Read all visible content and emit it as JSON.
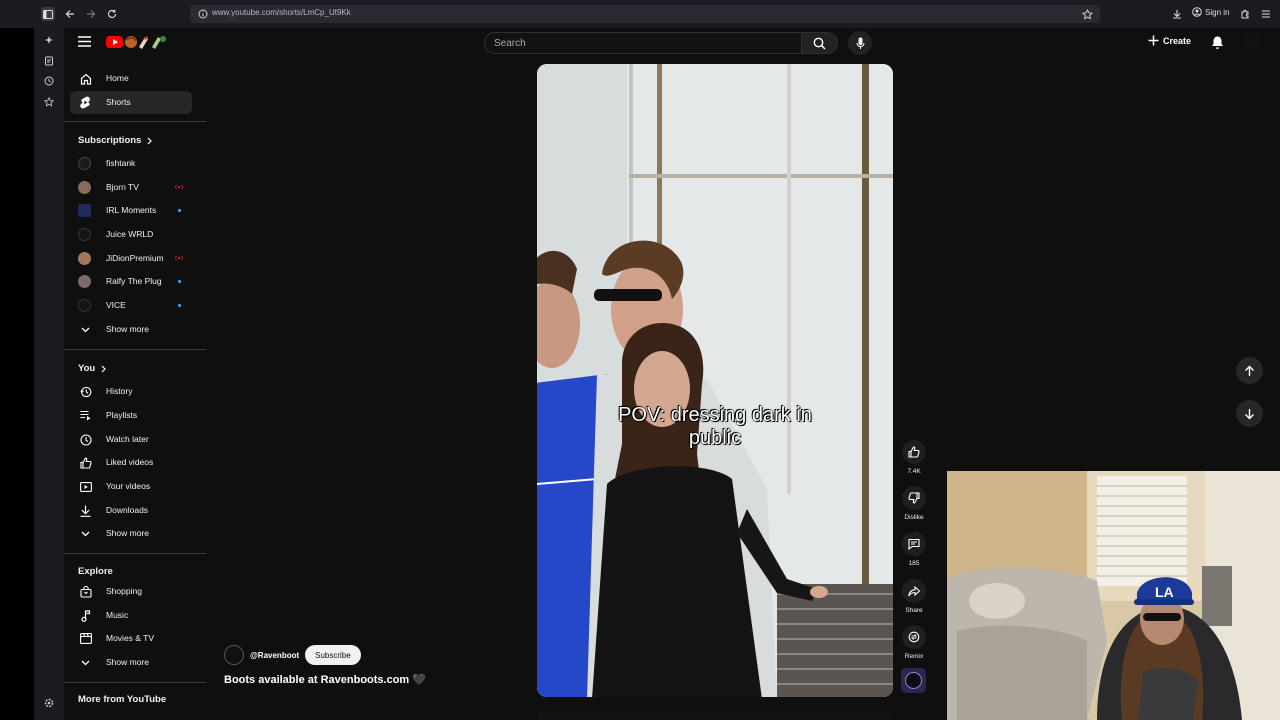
{
  "browser": {
    "url": "www.youtube.com/shorts/LmCp_Ut9Kk",
    "signin_label": "Sign in"
  },
  "header": {
    "search_placeholder": "Search",
    "create_label": "Create"
  },
  "sidebar": {
    "main": [
      {
        "label": "Home",
        "icon": "home-icon"
      },
      {
        "label": "Shorts",
        "icon": "shorts-icon",
        "active": true
      }
    ],
    "subscriptions_title": "Subscriptions",
    "subscriptions": [
      {
        "label": "fishtank",
        "status": ""
      },
      {
        "label": "Bjorn TV",
        "status": "live"
      },
      {
        "label": "IRL Moments",
        "status": "new"
      },
      {
        "label": "Juice WRLD",
        "status": ""
      },
      {
        "label": "JiDionPremium",
        "status": "live"
      },
      {
        "label": "Ralfy The Plug",
        "status": "new"
      },
      {
        "label": "VICE",
        "status": "new"
      }
    ],
    "subs_show_more": "Show more",
    "you_title": "You",
    "you_items": [
      {
        "label": "History",
        "icon": "history-icon"
      },
      {
        "label": "Playlists",
        "icon": "playlists-icon"
      },
      {
        "label": "Watch later",
        "icon": "watch-later-icon"
      },
      {
        "label": "Liked videos",
        "icon": "like-icon"
      },
      {
        "label": "Your videos",
        "icon": "your-videos-icon"
      },
      {
        "label": "Downloads",
        "icon": "download-icon"
      }
    ],
    "you_show_more": "Show more",
    "explore_title": "Explore",
    "explore_items": [
      {
        "label": "Shopping",
        "icon": "shopping-icon"
      },
      {
        "label": "Music",
        "icon": "music-icon"
      },
      {
        "label": "Movies & TV",
        "icon": "movies-icon"
      }
    ],
    "explore_show_more": "Show more",
    "more_title": "More from YouTube"
  },
  "short": {
    "caption_line1": "POV: dressing dark in",
    "caption_line2": "public",
    "like_count": "7.4K",
    "dislike_label": "Dislike",
    "comment_count": "185",
    "share_label": "Share",
    "remix_label": "Remix",
    "channel_handle": "@Ravenboot",
    "subscribe_label": "Subscribe",
    "title": "Boots available at Ravenboots.com 🖤"
  },
  "colors": {
    "background": "#0f0f0f",
    "brand_red": "#ff0000",
    "accent_blue": "#3ea6ff"
  }
}
